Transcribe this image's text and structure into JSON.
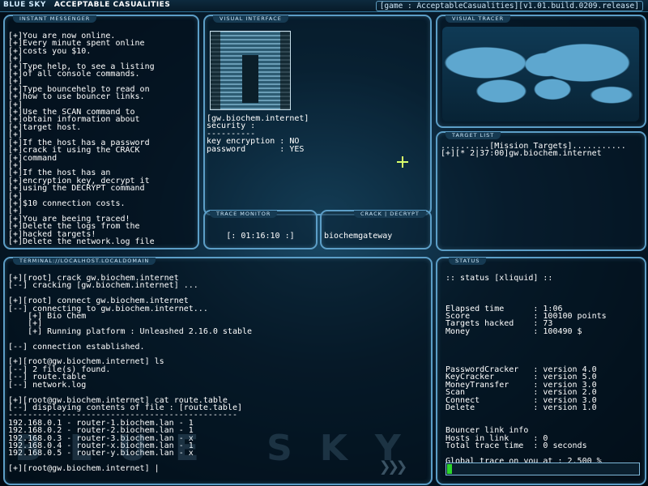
{
  "header": {
    "brand_left": "BLUE SKY",
    "brand_right": "ACCEPTABLE CASUALITIES",
    "game_info": "[game : AcceptableCasualities][v1.01.build.0209.release]"
  },
  "panels": {
    "instant_messenger": {
      "title": "INSTANT MESSENGER",
      "text": "[+]You are now online.\n[+]Every minute spent online\n[+]costs you $10.\n[+]\n[+]Type help, to see a listing\n[+]of all console commands.\n[+]\n[+]Type bouncehelp to read on\n[+]how to use bouncer links.\n[+]\n[+]Use the SCAN command to\n[+]obtain information about\n[+]target host.\n[+]\n[+]If the host has a password\n[+]crack it using the CRACK\n[+]command\n[+]\n[+]If the host has an\n[+]encryption key, decrypt it\n[+]using the DECRYPT command\n[+]\n[+]$10 connection costs.\n[+]\n[+]You are beeing traced!\n[+]Delete the logs from the\n[+]hacked targets!\n[+]Delete the network.log file"
    },
    "visual_interface": {
      "title": "VISUAL INTERFACE",
      "info": "[gw.biochem.internet]\nsecurity :\n----------\nkey encryption : NO\npassword       : YES"
    },
    "visual_tracer": {
      "title": "VISUAL TRACER"
    },
    "target_list": {
      "title": "TARGET LIST",
      "text": "..........[Mission Targets]...........\n[+][* 2|37:00]gw.biochem.internet"
    },
    "trace_monitor": {
      "title": "TRACE MONITOR",
      "value": "[: 01:16:10 :]"
    },
    "crack_decrypt": {
      "title": "CRACK | DECRYPT",
      "value": "biochemgateway"
    },
    "terminal": {
      "title": "TERMINAL://LOCALHOST.LOCALDOMAIN",
      "text": "[+][root] crack gw.biochem.internet\n[--] cracking [gw.biochem.internet] ...\n\n[+][root] connect gw.biochem.internet\n[--] connecting to gw.biochem.internet...\n    [+] Bio Chem\n    [+]\n    [+] Running platform : Unleashed 2.16.0 stable\n\n[--] connection established.\n\n[+][root@gw.biochem.internet] ls\n[--] 2 file(s) found.\n[--] route.table\n[--] network.log\n\n[+][root@gw.biochem.internet] cat route.table\n[--] displaying contents of file : [route.table]\n-----------------------------------------------\n192.168.0.1 - router-1.biochem.lan - 1\n192.168.0.2 - router-2.biochem.lan - 1\n192.168.0.3 - router-3.biochem.lan - x\n192.168.0.4 - router-x.biochem.lan - 1\n192.168.0.5 - router-y.biochem.lan - x\n\n[+][root@gw.biochem.internet] |",
      "watermark": "BLUE SKY",
      "arrows": "❯❯❯"
    },
    "status": {
      "title": "STATUS",
      "text": ":: status [xliquid] ::\n\n\n\nElapsed time      : 1:06\nScore             : 100100 points\nTargets hacked    : 73\nMoney             : 100490 $\n\n\n\n\nPasswordCracker   : version 4.0\nKeyCracker        : version 5.0\nMoneyTransfer     : version 3.0\nScan              : version 2.0\nConnect           : version 3.0\nDelete            : version 1.0\n\n\nBouncer link info\nHosts in link     : 0\nTotal trace time  : 0 seconds\n\nGlobal trace on you at : 2.500 %",
      "trace_percent": 2.5
    }
  },
  "colors": {
    "panel_border": "#5c9ec7",
    "trace_bar": "#2bd62b",
    "crosshair": "#d8ff6a"
  }
}
